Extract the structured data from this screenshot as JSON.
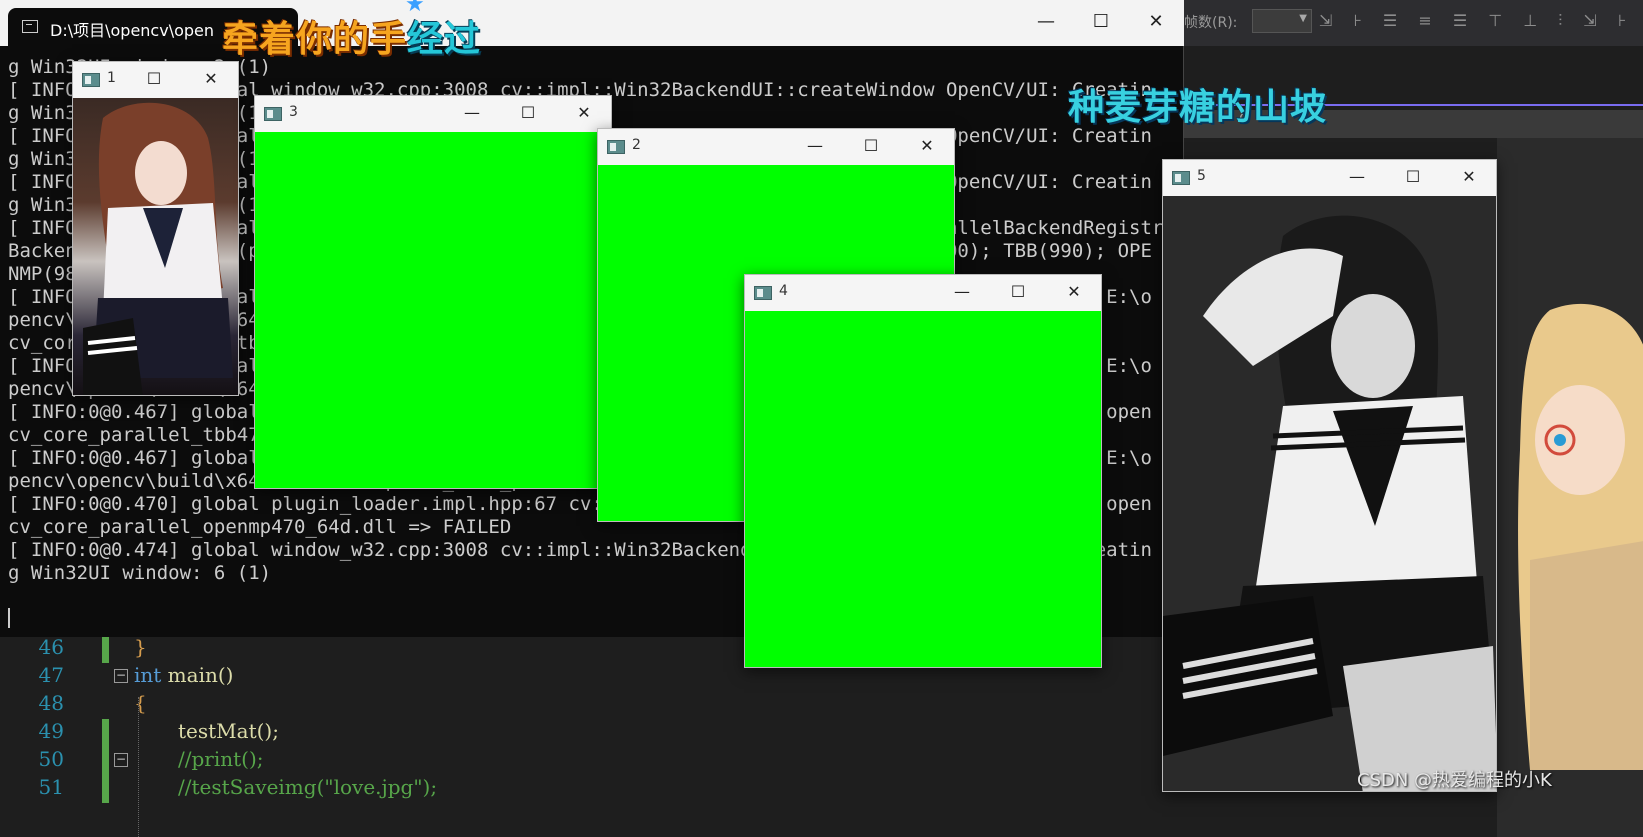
{
  "vs_toolbar": {
    "label": "帧数(R):",
    "combo_value": "",
    "doc_strip_value": "0"
  },
  "editor": {
    "lines": [
      {
        "number": "46",
        "text": "}"
      },
      {
        "number": "47",
        "keyword": "int",
        "text": " main()"
      },
      {
        "number": "48",
        "text": "{"
      },
      {
        "number": "49",
        "text": "testMat();"
      },
      {
        "number": "50",
        "text": "//print();"
      },
      {
        "number": "51",
        "text": "//testSaveimg(\"love.jpg\");"
      }
    ]
  },
  "console": {
    "tab_title": "D:\\项目\\opencv\\open",
    "controls": {
      "minimize": "—",
      "maximize": "☐",
      "close": "✕"
    },
    "lines": [
      "g Win32UI window: 2 (1)",
      "[ INFO:0@0.1xx] global window_w32.cpp:3008 cv::impl::Win32BackendUI::createWindow OpenCV/UI: Creatin",
      "g Win32UI window: 3 (1)",
      "[ INFO:0@0.2xx] global window_w32.cpp:3008 cv::impl::Win32BackendUI::createWindow OpenCV/UI: Creatin",
      "g Win32UI window: 4 (1)",
      "[ INFO:0@0.3xx] global window_w32.cpp:3008 cv::impl::Win32BackendUI::createWindow OpenCV/UI: Creatin",
      "g Win32UI window: 5 (1)",
      "[ INFO:0@0.4xx] global parallel.cpp:xxx cv::parallel::ParallelBackendRegistry::ParallelBackendRegistry::Parallel",
      "BackendRegistry core(parallel): Enabled backends(3, sorted by priority): ONETBB(1000); TBB(990); OPE",
      "NMP(980)",
      "[ INFO:0@0.4xx] global plugin_loader.impl.hpp:67 cv::plugin::impl::DynamicLib::libraryLoad load E:\\o",
      "pencv\\opencv\\build\\x64\\vc16\\bin\\opencv_core_parallel_onetbb470_64d.dll => FAILED open",
      "cv_core_parallel_onetbb470_64d.dll => FAILED",
      "[ INFO:0@0.4xx] global plugin_loader.impl.hpp:67 cv::plugin::impl::DynamicLib::libraryLoad load E:\\o",
      "pencv\\opencv\\build\\x64\\vc16\\bin\\opencv_core_parallel_tbb470_64d.dll => FAILED",
      "[ INFO:0@0.467] global plugin_loader.impl.hpp:67 cv::plugin::impl::DynamicLib::libraryLoad load open",
      "cv_core_parallel_tbb470_64d.dll => FAILED",
      "[ INFO:0@0.467] global plugin_loader.impl.hpp:67 cv::plugin::impl::DynamicLib::libraryLoad load E:\\o",
      "pencv\\opencv\\build\\x64\\vc16\\bin\\opencv_core_parallel_openmp470_64d.dll => FAILED",
      "[ INFO:0@0.470] global plugin_loader.impl.hpp:67 cv::plugin::impl::DynamicLib::libraryLoad load open",
      "cv_core_parallel_openmp470_64d.dll => FAILED",
      "[ INFO:0@0.474] global window_w32.cpp:3008 cv::impl::Win32BackendUI::createWindow OpenCV/UI: Creatin",
      "g Win32UI window: 6 (1)"
    ]
  },
  "cv_windows": [
    {
      "id": "win1",
      "title": "1",
      "content": "color-photo"
    },
    {
      "id": "win3",
      "title": "3",
      "content": "green"
    },
    {
      "id": "win2",
      "title": "2",
      "content": "green"
    },
    {
      "id": "win4",
      "title": "4",
      "content": "green"
    },
    {
      "id": "win5",
      "title": "5",
      "content": "grayscale-photo"
    }
  ],
  "cv_controls": {
    "minimize": "—",
    "maximize": "☐",
    "close": "✕"
  },
  "colors": {
    "green_image": "#00ff00",
    "console_bg": "#0c0c0c",
    "editor_bg": "#1e1e1e"
  },
  "lyrics": {
    "line1_orange": "牵着你的手",
    "line1_cyan": "经过",
    "line2": "种麦芽糖的山坡"
  },
  "watermark": "CSDN @热爱编程的小K"
}
